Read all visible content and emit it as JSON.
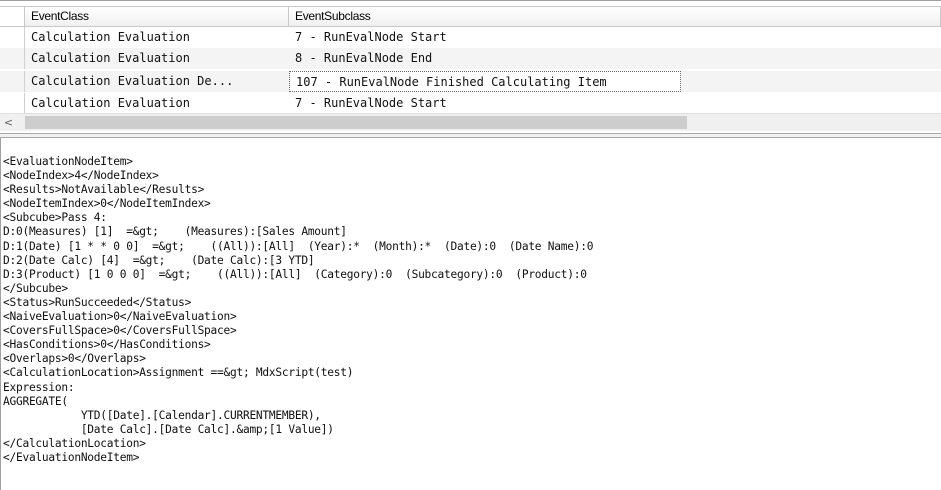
{
  "grid": {
    "columns": [
      "EventClass",
      "EventSubclass"
    ],
    "rows": [
      {
        "event_class": "Calculation Evaluation",
        "event_subclass": "7 - RunEvalNode Start"
      },
      {
        "event_class": "Calculation Evaluation",
        "event_subclass": "8 - RunEvalNode End"
      },
      {
        "event_class": "Calculation Evaluation De...",
        "event_subclass": "107 - RunEvalNode Finished Calculating Item"
      },
      {
        "event_class": "Calculation Evaluation",
        "event_subclass": "7 - RunEvalNode Start"
      }
    ],
    "selected_row_index": 2,
    "scroll_left_arrow": "<"
  },
  "detail": {
    "lines": [
      "<EvaluationNodeItem>",
      "<NodeIndex>4</NodeIndex>",
      "<Results>NotAvailable</Results>",
      "<NodeItemIndex>0</NodeItemIndex>",
      "<Subcube>Pass 4:",
      "D:0(Measures) [1]  =&gt;    (Measures):[Sales Amount]",
      "D:1(Date) [1 * * 0 0]  =&gt;    ((All)):[All]  (Year):*  (Month):*  (Date):0  (Date Name):0",
      "D:2(Date Calc) [4]  =&gt;    (Date Calc):[3 YTD]",
      "D:3(Product) [1 0 0 0]  =&gt;    ((All)):[All]  (Category):0  (Subcategory):0  (Product):0",
      "</Subcube>",
      "<Status>RunSucceeded</Status>",
      "<NaiveEvaluation>0</NaiveEvaluation>",
      "<CoversFullSpace>0</CoversFullSpace>",
      "<HasConditions>0</HasConditions>",
      "<Overlaps>0</Overlaps>",
      "<CalculationLocation>Assignment ==&gt; MdxScript(test)",
      "Expression:",
      "AGGREGATE(",
      "            YTD([Date].[Calendar].CURRENTMEMBER),",
      "            [Date Calc].[Date Calc].&amp;[1 Value])",
      "</CalculationLocation>",
      "</EvaluationNodeItem>"
    ]
  }
}
